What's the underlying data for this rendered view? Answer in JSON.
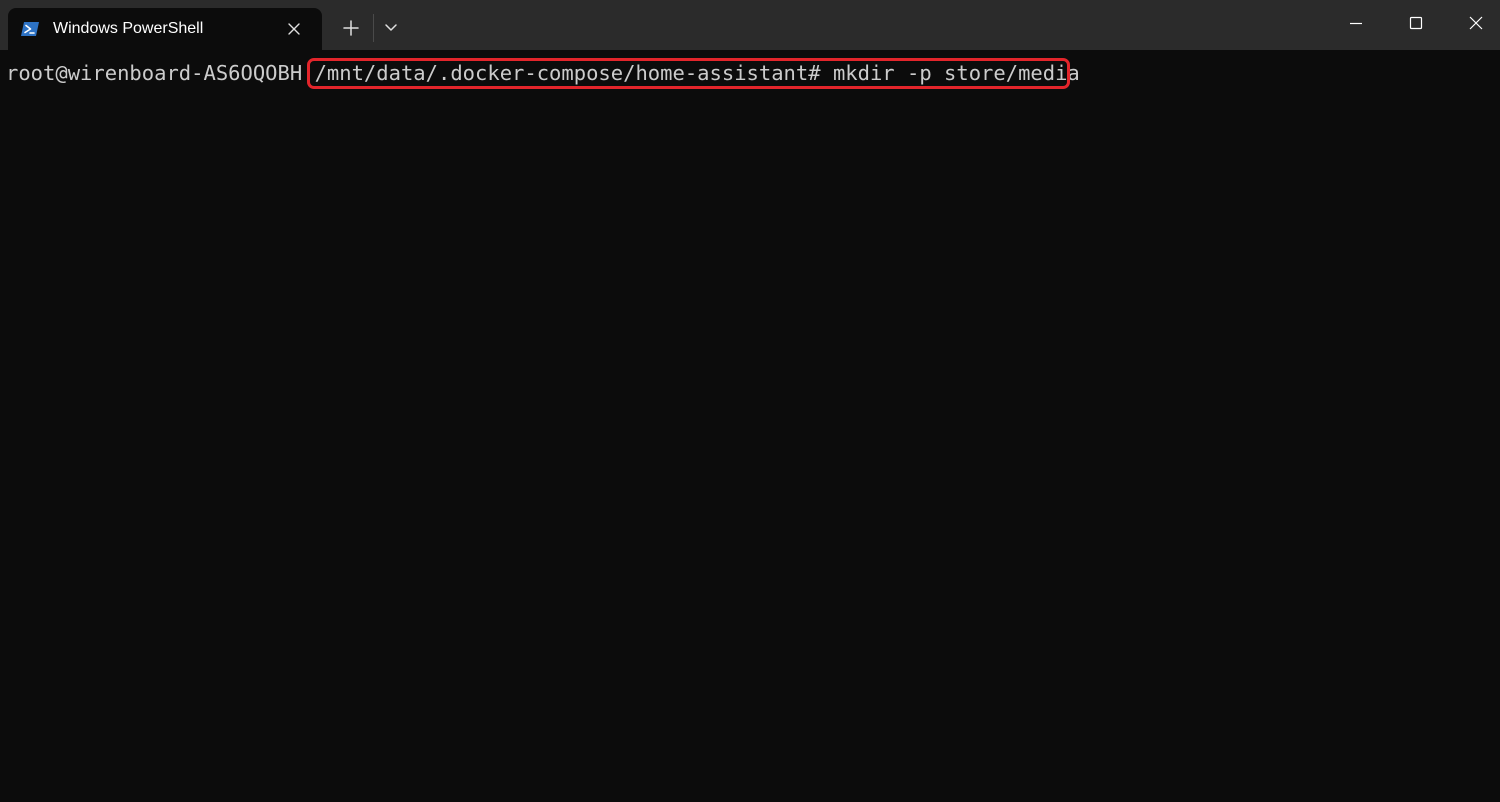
{
  "window": {
    "tab_title": "Windows PowerShell",
    "tab_icon": "powershell-icon",
    "new_tab_icon": "plus-icon",
    "dropdown_icon": "chevron-down-icon",
    "controls": [
      "minimize-icon",
      "maximize-icon",
      "close-icon"
    ]
  },
  "terminal": {
    "prompt_user_host": "root@wirenboard-AS6OQOBH:",
    "prompt_path": "/mnt/data/.docker-compose/home-assistant",
    "prompt_symbol": "# ",
    "command": "mkdir -p store/media"
  },
  "annotation": {
    "highlight_color": "#e3252b"
  },
  "colors": {
    "background": "#0c0c0c",
    "titlebar": "#2b2b2b",
    "text": "#cccccc"
  }
}
